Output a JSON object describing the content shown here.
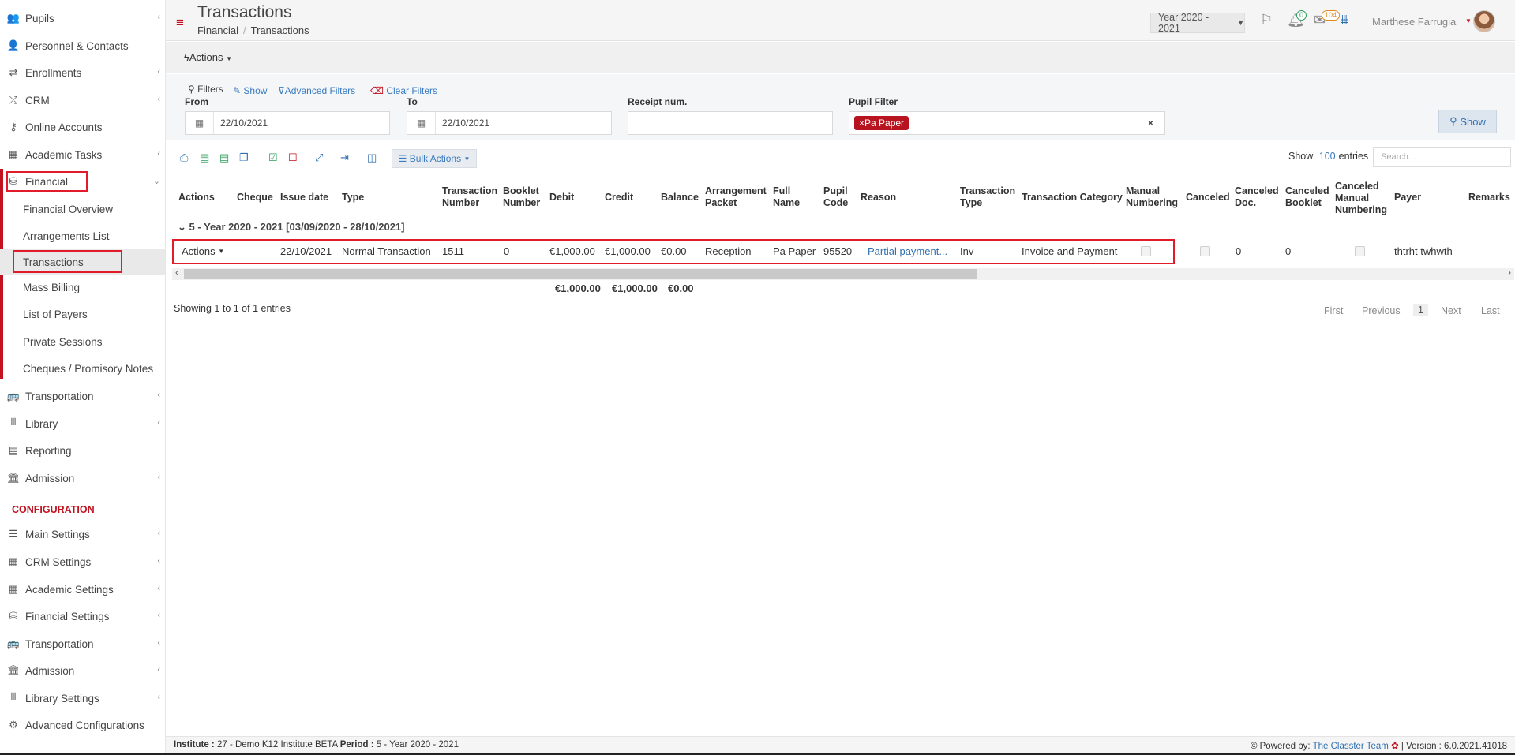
{
  "sidebar": {
    "items": [
      {
        "label": "Pupils",
        "icon": "users-icon",
        "chevron": true
      },
      {
        "label": "Personnel & Contacts",
        "icon": "user-icon",
        "chevron": false
      },
      {
        "label": "Enrollments",
        "icon": "exchange-icon",
        "chevron": true
      },
      {
        "label": "CRM",
        "icon": "shuffle-icon",
        "chevron": true
      },
      {
        "label": "Online Accounts",
        "icon": "key-icon",
        "chevron": false
      },
      {
        "label": "Academic Tasks",
        "icon": "grid-icon",
        "chevron": true
      },
      {
        "label": "Financial",
        "icon": "coins-icon",
        "chevron": true
      }
    ],
    "financial_sub": [
      "Financial Overview",
      "Arrangements List",
      "Transactions",
      "Mass Billing",
      "List of Payers",
      "Private Sessions",
      "Cheques / Promisory Notes"
    ],
    "items2": [
      {
        "label": "Transportation",
        "icon": "bus-icon",
        "chevron": true
      },
      {
        "label": "Library",
        "icon": "books-icon",
        "chevron": true
      },
      {
        "label": "Reporting",
        "icon": "report-icon",
        "chevron": false
      },
      {
        "label": "Admission",
        "icon": "bank-icon",
        "chevron": true
      }
    ],
    "config_title": "CONFIGURATION",
    "config_items": [
      {
        "label": "Main Settings",
        "icon": "sliders-icon",
        "chevron": true
      },
      {
        "label": "CRM Settings",
        "icon": "grid-settings-icon",
        "chevron": true
      },
      {
        "label": "Academic Settings",
        "icon": "grid-icon",
        "chevron": true
      },
      {
        "label": "Financial Settings",
        "icon": "coins-icon",
        "chevron": true
      },
      {
        "label": "Transportation",
        "icon": "bus-icon",
        "chevron": true
      },
      {
        "label": "Admission",
        "icon": "bank-icon",
        "chevron": true
      },
      {
        "label": "Library Settings",
        "icon": "books-icon",
        "chevron": true
      },
      {
        "label": "Advanced Configurations",
        "icon": "cogs-icon",
        "chevron": false
      }
    ]
  },
  "header": {
    "title": "Transactions",
    "breadcrumb": [
      "Financial",
      "Transactions"
    ],
    "year_select": "Year 2020 - 2021",
    "notif_badge": "0",
    "mail_badge": "104",
    "user_name": "Marthese Farrugia"
  },
  "actions_label": "Actions",
  "filters": {
    "title": "Filters",
    "show_link": "Show",
    "advanced_link": "Advanced Filters",
    "clear_link": "Clear Filters",
    "from_label": "From",
    "from_value": "22/10/2021",
    "to_label": "To",
    "to_value": "22/10/2021",
    "receipt_label": "Receipt num.",
    "receipt_value": "",
    "pupil_label": "Pupil Filter",
    "pupil_tag": "Pa Paper",
    "show_button": "Show"
  },
  "toolbar": {
    "bulk_actions": "Bulk Actions",
    "show_label": "Show",
    "entries_num": "100",
    "entries_label": "entries",
    "search_placeholder": "Search..."
  },
  "table": {
    "columns": [
      "Actions",
      "Cheque",
      "Issue date",
      "Type",
      "Transaction Number",
      "Booklet Number",
      "Debit",
      "Credit",
      "Balance",
      "Arrangement Packet",
      "Full Name",
      "Pupil Code",
      "Reason",
      "Transaction Type",
      "Transaction Category",
      "Manual Numbering",
      "Canceled",
      "Canceled Doc.",
      "Canceled Booklet",
      "Canceled Manual Numbering",
      "Payer",
      "Remarks"
    ],
    "group_label": "5 - Year 2020 - 2021 [03/09/2020 - 28/10/2021]",
    "row": {
      "actions": "Actions",
      "issue_date": "22/10/2021",
      "type": "Normal Transaction",
      "transaction_number": "1511",
      "booklet_number": "0",
      "debit": "€1,000.00",
      "credit": "€1,000.00",
      "balance": "€0.00",
      "arrangement_packet": "Reception",
      "full_name": "Pa Paper",
      "pupil_code": "95520",
      "reason": "Partial payment...",
      "transaction_type": "Inv",
      "transaction_category": "Invoice and Payment",
      "canceled_doc": "0",
      "canceled_booklet": "0",
      "payer": "thtrht twhwth"
    },
    "totals": {
      "debit": "€1,000.00",
      "credit": "€1,000.00",
      "balance": "€0.00"
    }
  },
  "info": "Showing 1 to 1 of 1 entries",
  "pager": {
    "first": "First",
    "previous": "Previous",
    "current": "1",
    "next": "Next",
    "last": "Last"
  },
  "footer": {
    "institute_label": "Institute :",
    "institute_value": "27 - Demo K12 Institute BETA",
    "period_label": "Period :",
    "period_value": "5 - Year 2020 - 2021",
    "powered_by": "Powered by:",
    "team": "The Classter Team",
    "version": "| Version : 6.0.2021.41018"
  },
  "colors": {
    "accent": "#c1121f",
    "link": "#2f6fb0",
    "highlight": "#e21b2a"
  }
}
